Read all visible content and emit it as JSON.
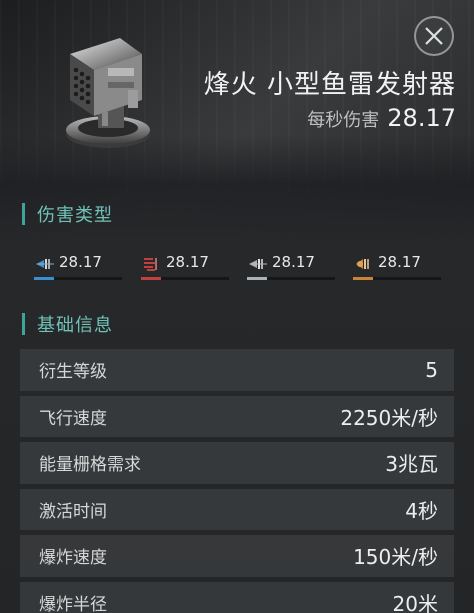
{
  "header": {
    "title": "烽火 小型鱼雷发射器",
    "dps_label": "每秒伤害",
    "dps_value": "28.17",
    "close_icon": "close-icon"
  },
  "damage_section": {
    "title": "伤害类型",
    "items": [
      {
        "icon": "em-damage-icon",
        "value": "28.17",
        "color": "#3a8fd0"
      },
      {
        "icon": "thermal-damage-icon",
        "value": "28.17",
        "color": "#c0403f"
      },
      {
        "icon": "kinetic-damage-icon",
        "value": "28.17",
        "color": "#a9b3b9"
      },
      {
        "icon": "explosive-damage-icon",
        "value": "28.17",
        "color": "#c7843a"
      }
    ]
  },
  "info_section": {
    "title": "基础信息",
    "rows": [
      {
        "label": "衍生等级",
        "value": "5"
      },
      {
        "label": "飞行速度",
        "value": "2250米/秒"
      },
      {
        "label": "能量栅格需求",
        "value": "3兆瓦"
      },
      {
        "label": "激活时间",
        "value": "4秒"
      },
      {
        "label": "爆炸速度",
        "value": "150米/秒"
      },
      {
        "label": "爆炸半径",
        "value": "20米"
      }
    ]
  },
  "colors": {
    "accent": "#3fa39a",
    "section_text": "#6fc2b7"
  }
}
